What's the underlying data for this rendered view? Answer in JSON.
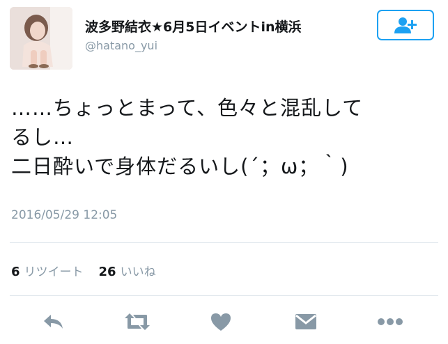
{
  "user": {
    "display_name": "波多野結衣★6月5日イベントin横浜",
    "handle": "@hatano_yui"
  },
  "follow_button": {
    "icon": "add-user-icon"
  },
  "tweet": {
    "lines": [
      "……ちょっとまって、色々と混乱して",
      "るし…",
      "二日酔いで身体だるいし(´；ω；｀)"
    ],
    "timestamp": "2016/05/29 12:05"
  },
  "stats": {
    "retweets_count": "6",
    "retweets_label": "リツイート",
    "likes_count": "26",
    "likes_label": "いいね"
  },
  "actions": [
    {
      "name": "reply",
      "icon": "reply-icon"
    },
    {
      "name": "retweet",
      "icon": "retweet-icon"
    },
    {
      "name": "like",
      "icon": "heart-icon"
    },
    {
      "name": "direct-message",
      "icon": "envelope-icon"
    },
    {
      "name": "more",
      "icon": "more-icon"
    }
  ],
  "colors": {
    "accent": "#1da1f2",
    "icon_gray": "#8899a6",
    "text": "#14171a"
  }
}
